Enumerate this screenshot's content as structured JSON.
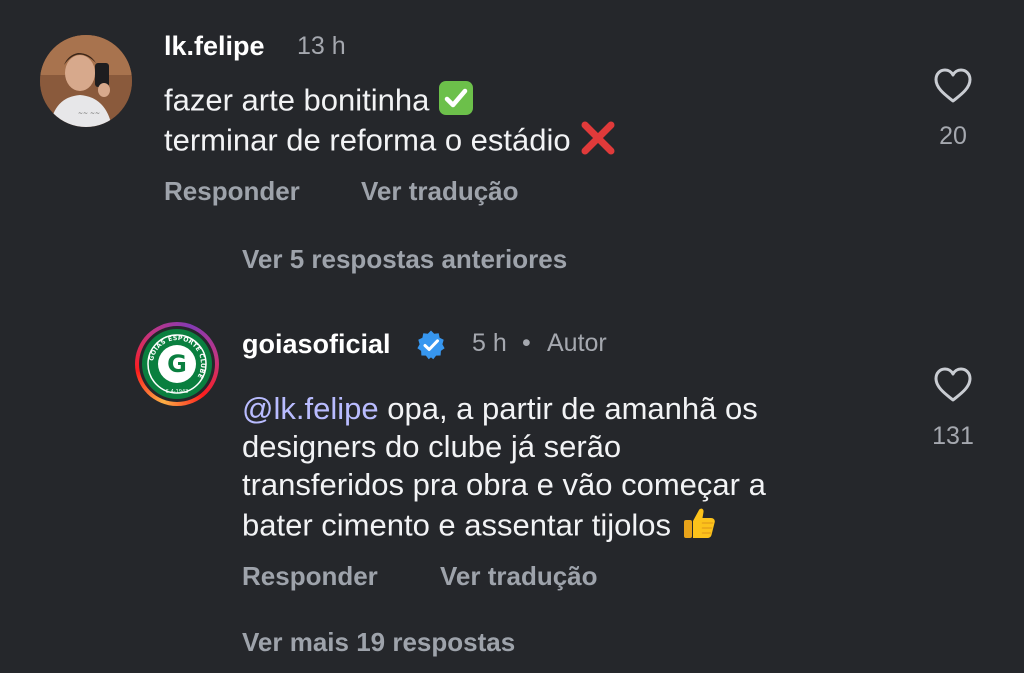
{
  "comment1": {
    "username": "lk.felipe",
    "time": "13 h",
    "lines": [
      "fazer arte bonitinha",
      "terminar de reforma o estádio"
    ],
    "like_count": "20",
    "reply_label": "Responder",
    "translate_label": "Ver tradução"
  },
  "replies_previous": "Ver 5 respostas anteriores",
  "comment2": {
    "username": "goiasoficial",
    "time": "5 h",
    "separator": "•",
    "author_badge": "Autor",
    "mention": "@lk.felipe",
    "lines": [
      "opa, a partir de amanhã os",
      "designers do clube já serão",
      "transferidos pra obra e vão começar a",
      "bater cimento e assentar tijolos"
    ],
    "like_count": "131",
    "reply_label": "Responder",
    "translate_label": "Ver tradução",
    "logo_text": "G",
    "logo_ring_text": "GOIÁS ESPORTE CLUBE",
    "logo_date": "6-4-1943"
  },
  "replies_more": "Ver mais 19 respostas",
  "icons": {
    "check_emoji": "check-mark-button",
    "cross_emoji": "cross-mark",
    "thumbs_emoji": "thumbs-up",
    "heart": "heart-outline",
    "verified": "verified-badge"
  },
  "colors": {
    "background": "#25272b",
    "verified_blue": "#3797f0",
    "check_green": "#6cc04a",
    "cross_red": "#e03a3a",
    "mention": "#b9bcff",
    "logo_green": "#0a7f3f"
  }
}
